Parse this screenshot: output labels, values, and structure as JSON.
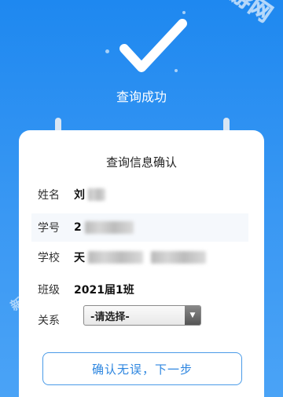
{
  "watermark": "新华手游网",
  "header": {
    "title": "查询成功"
  },
  "card": {
    "title": "查询信息确认",
    "name_label": "姓名",
    "name_value_visible": "刘",
    "id_label": "学号",
    "id_value_visible": "2",
    "school_label": "学校",
    "school_value_visible": "天",
    "class_label": "班级",
    "class_value": "2021届1班",
    "relation_label": "关系",
    "relation_selected": "-请选择-"
  },
  "actions": {
    "confirm_label": "确认无误，下一步"
  },
  "icons": [
    "check-icon",
    "chevron-down-icon"
  ],
  "colors": {
    "background": "#1E88F0",
    "accent": "#2D86E0",
    "card": "#FFFFFF"
  }
}
